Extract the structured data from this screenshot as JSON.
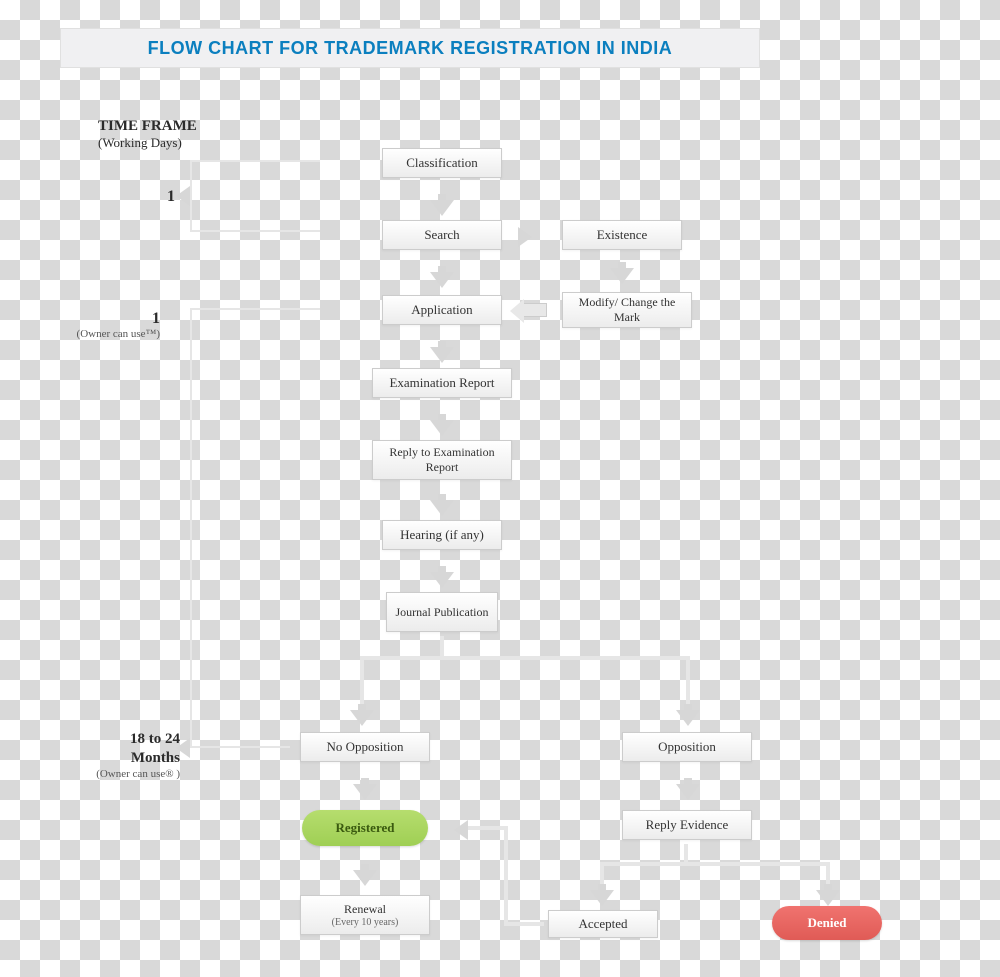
{
  "title": "FLOW CHART FOR TRADEMARK REGISTRATION IN INDIA",
  "timeframe": {
    "title": "TIME FRAME",
    "sub": "(Working Days)"
  },
  "times": {
    "t1": {
      "big": "1"
    },
    "t2": {
      "big": "1",
      "sm": "(Owner can use™)"
    },
    "t3": {
      "mid1": "18 to 24",
      "mid2": "Months",
      "sm": "(Owner can use® )"
    }
  },
  "nodes": {
    "classification": "Classification",
    "search": "Search",
    "existence": "Existence",
    "modify": "Modify/ Change the Mark",
    "application": "Application",
    "exam": "Examination Report",
    "reply_exam": "Reply to Examination Report",
    "hearing": "Hearing (if any)",
    "journal": "Journal Publication",
    "no_opp": "No Opposition",
    "opp": "Opposition",
    "registered": "Registered",
    "reply_ev": "Reply Evidence",
    "renewal": "Renewal",
    "renewal_sub": "(Every 10 years)",
    "accepted": "Accepted",
    "denied": "Denied"
  }
}
